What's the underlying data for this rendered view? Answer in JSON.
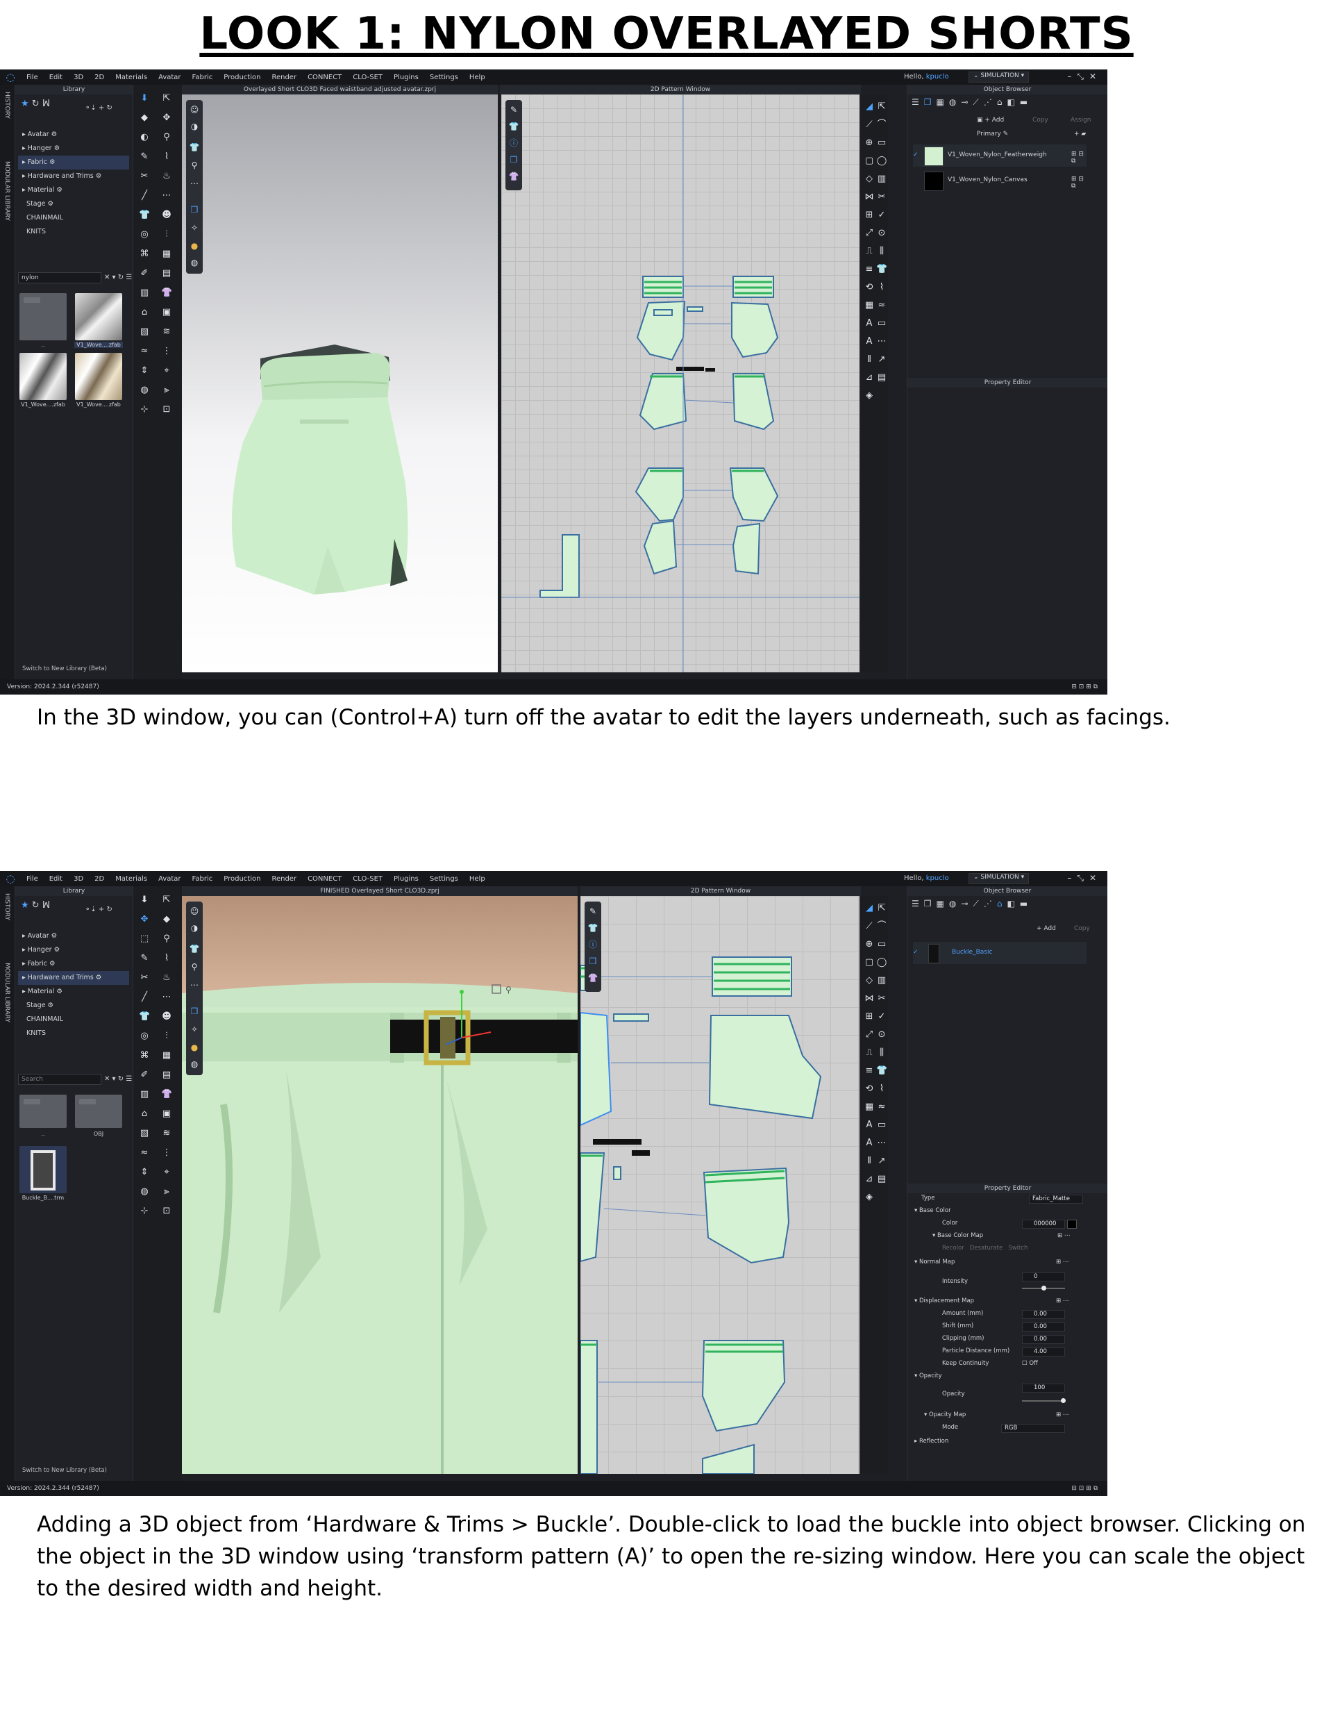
{
  "title": "LOOK 1: NYLON OVERLAYED SHORTS",
  "captions": {
    "first": "In the 3D window, you can (Control+A) turn off the avatar to edit the layers underneath, such as facings.",
    "second": "Adding a 3D object from ‘Hardware & Trims > Buckle’. Double-click to load the buckle into object browser. Clicking on the object in the 3D window using ‘transform pattern (A)’ to open the re-sizing window. Here you can scale the object to the desired width and height."
  },
  "menu": [
    "File",
    "Edit",
    "3D",
    "2D",
    "Materials",
    "Avatar",
    "Fabric",
    "Production",
    "Render",
    "CONNECT",
    "CLO-SET",
    "Plugins",
    "Settings",
    "Help"
  ],
  "user": {
    "greeting": "Hello,",
    "name": "kpuclo"
  },
  "simulation_label": "SIMULATION",
  "side_tabs": {
    "history": "HISTORY",
    "modular": "MODULAR LIBRARY"
  },
  "library": {
    "header": "Library",
    "tree": [
      "Avatar",
      "Hanger",
      "Fabric",
      "Hardware and Trims",
      "Material",
      "Stage",
      "CHAINMAIL",
      "KNITS"
    ],
    "switch": "Switch to New Library (Beta)"
  },
  "version": "Version: 2024.2.344 (r52487)",
  "shot1": {
    "selected_tree": "Fabric",
    "search_value": "nylon",
    "thumbs": [
      "..",
      "V1_Wove....zfab",
      "V1_Wove....zfab",
      "V1_Wove....zfab"
    ],
    "window_3d_title": "Overlayed Short CLO3D Faced waistband adjusted avatar.zprj",
    "window_2d_title": "2D Pattern Window",
    "object_browser": "Object Browser",
    "add": "+ Add",
    "copy": "Copy",
    "assign": "Assign",
    "primary": "Primary",
    "fabrics": [
      {
        "name": "V1_Woven_Nylon_Featherweigh",
        "color": "#d3f0d1"
      },
      {
        "name": "V1_Woven_Nylon_Canvas",
        "color": "#000000"
      }
    ],
    "property_editor": "Property Editor"
  },
  "shot2": {
    "selected_tree": "Hardware and Trims",
    "search_placeholder": "Search",
    "thumbs": [
      "..",
      "OBJ",
      "Buckle_B....trm"
    ],
    "window_3d_title": "FINISHED Overlayed Short CLO3D.zprj",
    "window_2d_title": "2D Pattern Window",
    "object_browser": "Object Browser",
    "add": "+ Add",
    "copy": "Copy",
    "object": "Buckle_Basic",
    "property_editor": "Property Editor",
    "props": {
      "type_label": "Type",
      "type_value": "Fabric_Matte",
      "base_color": "Base Color",
      "color_label": "Color",
      "color_value": "000000",
      "base_color_map": "Base Color Map",
      "recolor": "Recolor",
      "desaturate": "Desaturate",
      "switch": "Switch",
      "normal_map": "Normal Map",
      "intensity_label": "Intensity",
      "intensity_value": "0",
      "displacement_map": "Displacement Map",
      "amount_label": "Amount (mm)",
      "amount_value": "0.00",
      "shift_label": "Shift (mm)",
      "shift_value": "0.00",
      "clipping_label": "Clipping (mm)",
      "clipping_value": "0.00",
      "particle_label": "Particle Distance (mm)",
      "particle_value": "4.00",
      "keep_label": "Keep Continuity",
      "keep_value": "Off",
      "opacity_section": "Opacity",
      "opacity_label": "Opacity",
      "opacity_value": "100",
      "opacity_map": "Opacity Map",
      "mode_label": "Mode",
      "mode_value": "RGB",
      "reflection": "Reflection"
    }
  },
  "colors": {
    "fabric_green": "#cdeecb",
    "accent": "#4ea1ff",
    "pattern_bg": "#cfcfcf",
    "ui_dark": "#1d1f24"
  }
}
